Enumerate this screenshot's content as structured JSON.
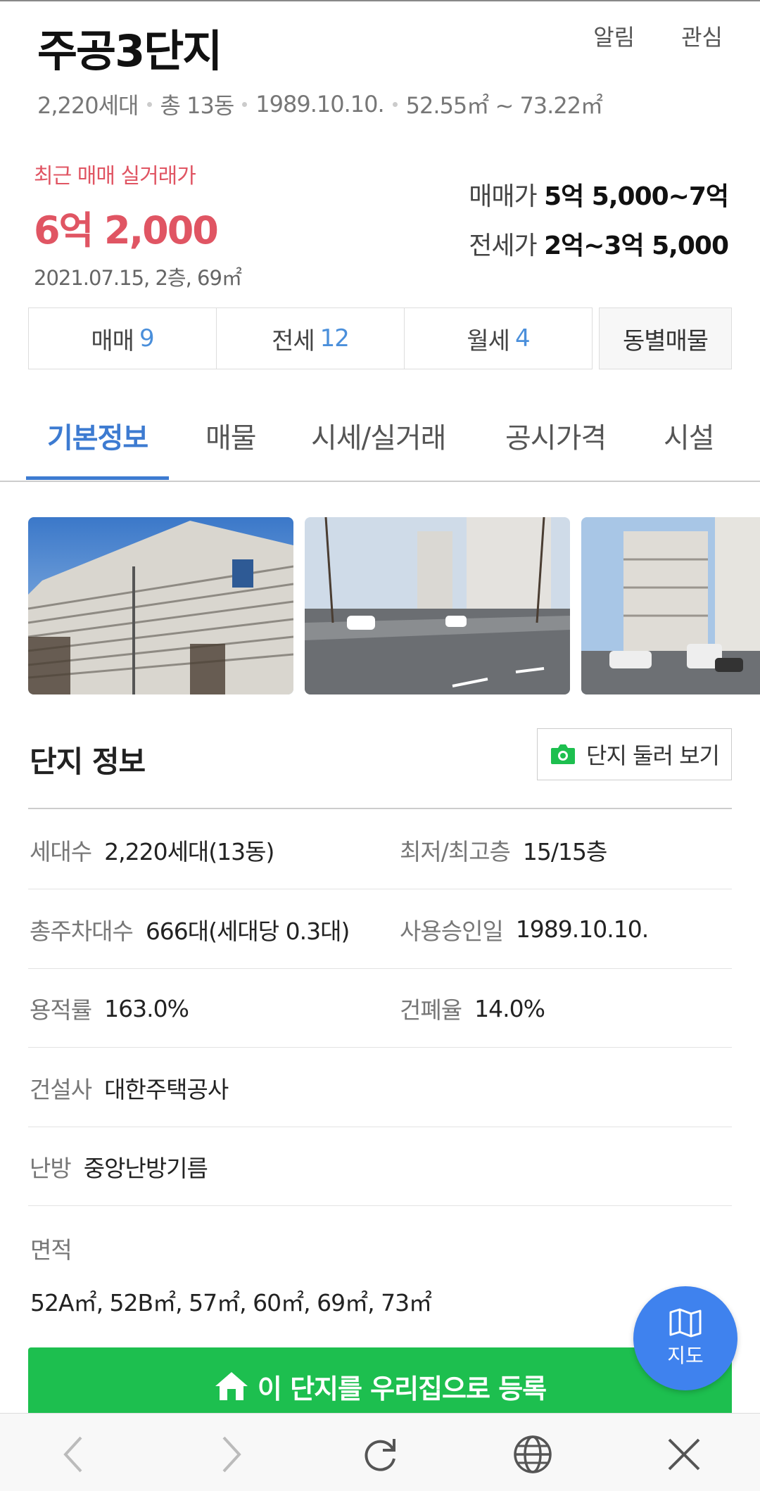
{
  "header": {
    "title": "주공3단지",
    "actions": {
      "alarm": "알림",
      "favorite": "관심"
    },
    "meta": [
      "2,220세대",
      "총 13동",
      "1989.10.10.",
      "52.55㎡ ~ 73.22㎡"
    ]
  },
  "recent_trade": {
    "label": "최근 매매 실거래가",
    "price": "6억 2,000",
    "info": "2021.07.15, 2층, 69㎡"
  },
  "price_range": {
    "sale_label": "매매가",
    "sale_value": "5억 5,000~7억",
    "jeonse_label": "전세가",
    "jeonse_value": "2억~3억 5,000"
  },
  "deal_tabs": [
    {
      "label": "매매",
      "count": "9"
    },
    {
      "label": "전세",
      "count": "12"
    },
    {
      "label": "월세",
      "count": "4"
    }
  ],
  "dong_tab": "동별매물",
  "nav_tabs": [
    "기본정보",
    "매물",
    "시세/실거래",
    "공시가격",
    "시설"
  ],
  "nav_active": "기본정보",
  "complex": {
    "title": "단지 정보",
    "tour_button": "단지 둘러 보기",
    "rows": [
      {
        "k1": "세대수",
        "v1": "2,220세대(13동)",
        "k2": "최저/최고층",
        "v2": "15/15층"
      },
      {
        "k1": "총주차대수",
        "v1": "666대(세대당 0.3대)",
        "k2": "사용승인일",
        "v2": "1989.10.10."
      },
      {
        "k1": "용적률",
        "v1": "163.0%",
        "k2": "건폐율",
        "v2": "14.0%"
      }
    ],
    "builder_label": "건설사",
    "builder_value": "대한주택공사",
    "heating_label": "난방",
    "heating_value": "중앙난방기름",
    "area_label": "면적",
    "area_value": "52A㎡, 52B㎡, 57㎡, 60㎡, 69㎡, 73㎡"
  },
  "register_button": "이 단지를 우리집으로 등록",
  "map_fab": "지도",
  "icons": {
    "camera": "camera-icon",
    "home": "home-icon",
    "map": "map-icon",
    "back": "chevron-left-icon",
    "forward": "chevron-right-icon",
    "reload": "reload-icon",
    "globe": "globe-icon",
    "close": "close-icon"
  },
  "colors": {
    "accent_blue": "#3d7bd1",
    "count_blue": "#4a8fdb",
    "price_red": "#e05563",
    "register_green": "#1dbf4f",
    "fab_blue": "#3f82ee"
  }
}
